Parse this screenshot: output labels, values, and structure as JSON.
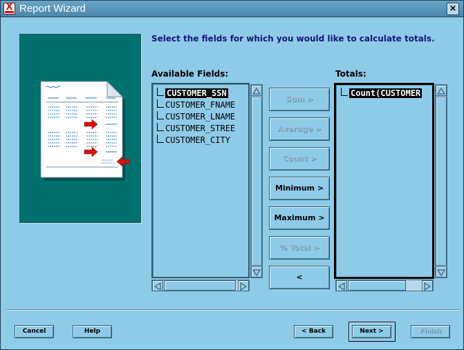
{
  "window": {
    "title": "Report Wizard",
    "close_glyph": "×"
  },
  "instruction": "Select the fields for which you would like to calculate totals.",
  "available": {
    "label": "Available Fields:",
    "items": [
      "CUSTOMER_SSN",
      "CUSTOMER_FNAME",
      "CUSTOMER_LNAME",
      "CUSTOMER_STREE",
      "CUSTOMER_CITY"
    ],
    "selected_index": 0
  },
  "totals": {
    "label": "Totals:",
    "items": [
      "Count(CUSTOMER"
    ],
    "selected_index": 0
  },
  "actions": {
    "sum": "Sum >",
    "average": "Average >",
    "count": "Count >",
    "minimum": "Minimum >",
    "maximum": "Maximum >",
    "pct_total": "% Total >",
    "remove": "<"
  },
  "footer": {
    "cancel": "Cancel",
    "help": "Help",
    "back": "< Back",
    "next": "Next >",
    "finish": "Finish"
  },
  "colors": {
    "dialog_bg": "#8ecbe9",
    "titlebar": "#4a86aa",
    "illustration_bg": "#00716f",
    "instruction_text": "#16167a"
  }
}
